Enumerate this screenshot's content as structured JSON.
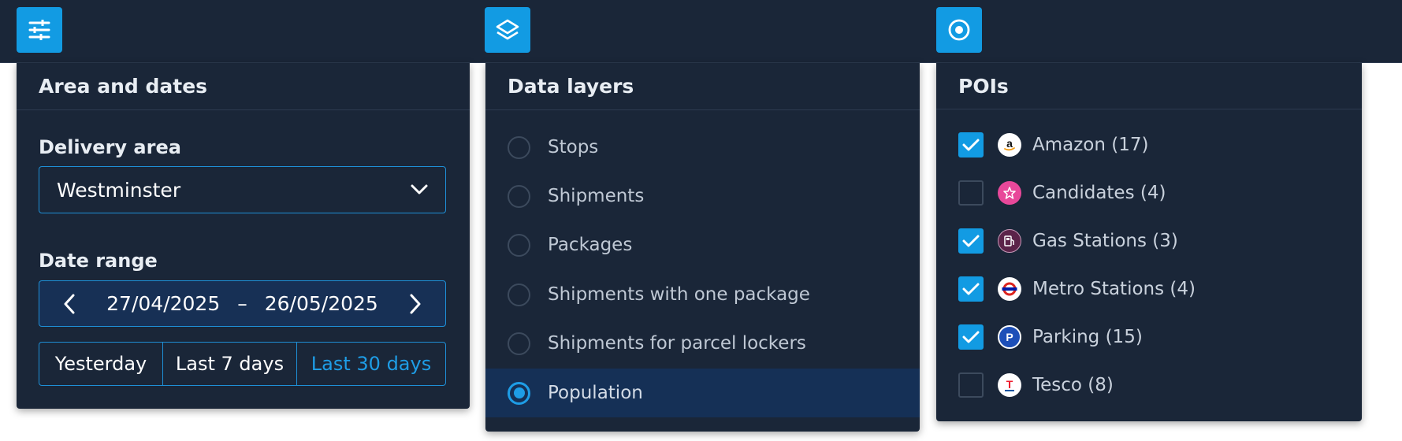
{
  "toolbar": {
    "buttons": [
      {
        "icon": "sliders-icon"
      },
      {
        "icon": "layers-icon"
      },
      {
        "icon": "target-icon"
      }
    ],
    "accent": "#129be3"
  },
  "area_panel": {
    "title": "Area and dates",
    "delivery_area_label": "Delivery area",
    "delivery_area_value": "Westminster",
    "date_range_label": "Date range",
    "date_from": "27/04/2025",
    "date_separator": "–",
    "date_to": "26/05/2025",
    "quick_ranges": [
      "Yesterday",
      "Last 7 days",
      "Last 30 days"
    ],
    "selected_quick_range": "Last 30 days"
  },
  "layers_panel": {
    "title": "Data layers",
    "layers": [
      {
        "label": "Stops",
        "selected": false
      },
      {
        "label": "Shipments",
        "selected": false
      },
      {
        "label": "Packages",
        "selected": false
      },
      {
        "label": "Shipments with one package",
        "selected": false
      },
      {
        "label": "Shipments for parcel lockers",
        "selected": false
      },
      {
        "label": "Population",
        "selected": true
      }
    ]
  },
  "pois_panel": {
    "title": "POIs",
    "items": [
      {
        "label": "Amazon (17)",
        "checked": true,
        "icon": "amazon-logo-icon",
        "color": "#ffffff"
      },
      {
        "label": "Candidates (4)",
        "checked": false,
        "icon": "star-icon",
        "color": "#e8489a"
      },
      {
        "label": "Gas Stations (3)",
        "checked": true,
        "icon": "gas-station-icon",
        "color": "#5b2349"
      },
      {
        "label": "Metro Stations (4)",
        "checked": true,
        "icon": "underground-roundel-icon",
        "color": "#ffffff"
      },
      {
        "label": "Parking (15)",
        "checked": true,
        "icon": "parking-icon",
        "color": "#1d4fb8"
      },
      {
        "label": "Tesco (8)",
        "checked": false,
        "icon": "tesco-logo-icon",
        "color": "#ffffff"
      }
    ]
  }
}
